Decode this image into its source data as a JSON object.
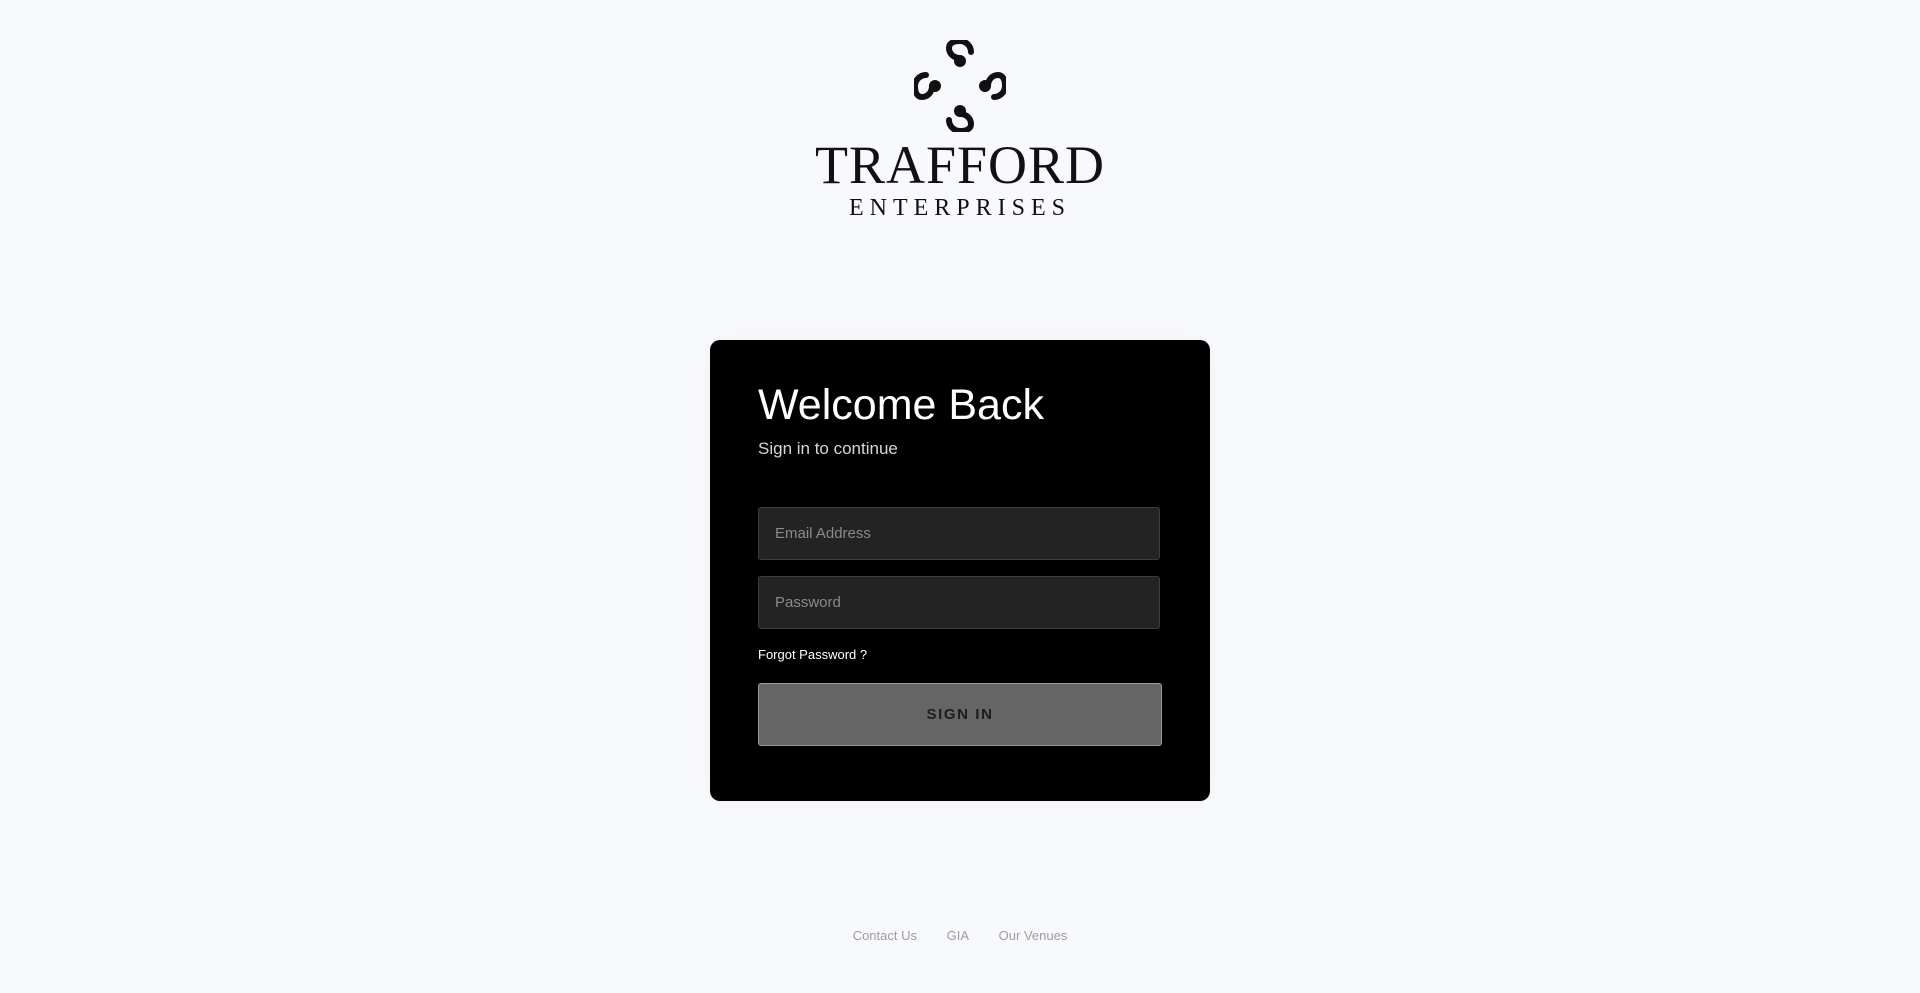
{
  "logo": {
    "brand_main": "TRAFFORD",
    "brand_sub": "ENTERPRISES",
    "mark_icon": "quatrefoil-swirl-icon"
  },
  "login": {
    "title": "Welcome Back",
    "subtitle": "Sign in to continue",
    "email_placeholder": "Email Address",
    "password_placeholder": "Password",
    "forgot_label": "Forgot Password ?",
    "signin_label": "SIGN IN"
  },
  "footer": {
    "links": [
      "Contact Us",
      "GIA",
      "Our Venues"
    ]
  },
  "colors": {
    "page_bg": "#f8f9fc",
    "card_bg": "#000000",
    "input_bg": "#232323",
    "button_bg": "#656565"
  }
}
